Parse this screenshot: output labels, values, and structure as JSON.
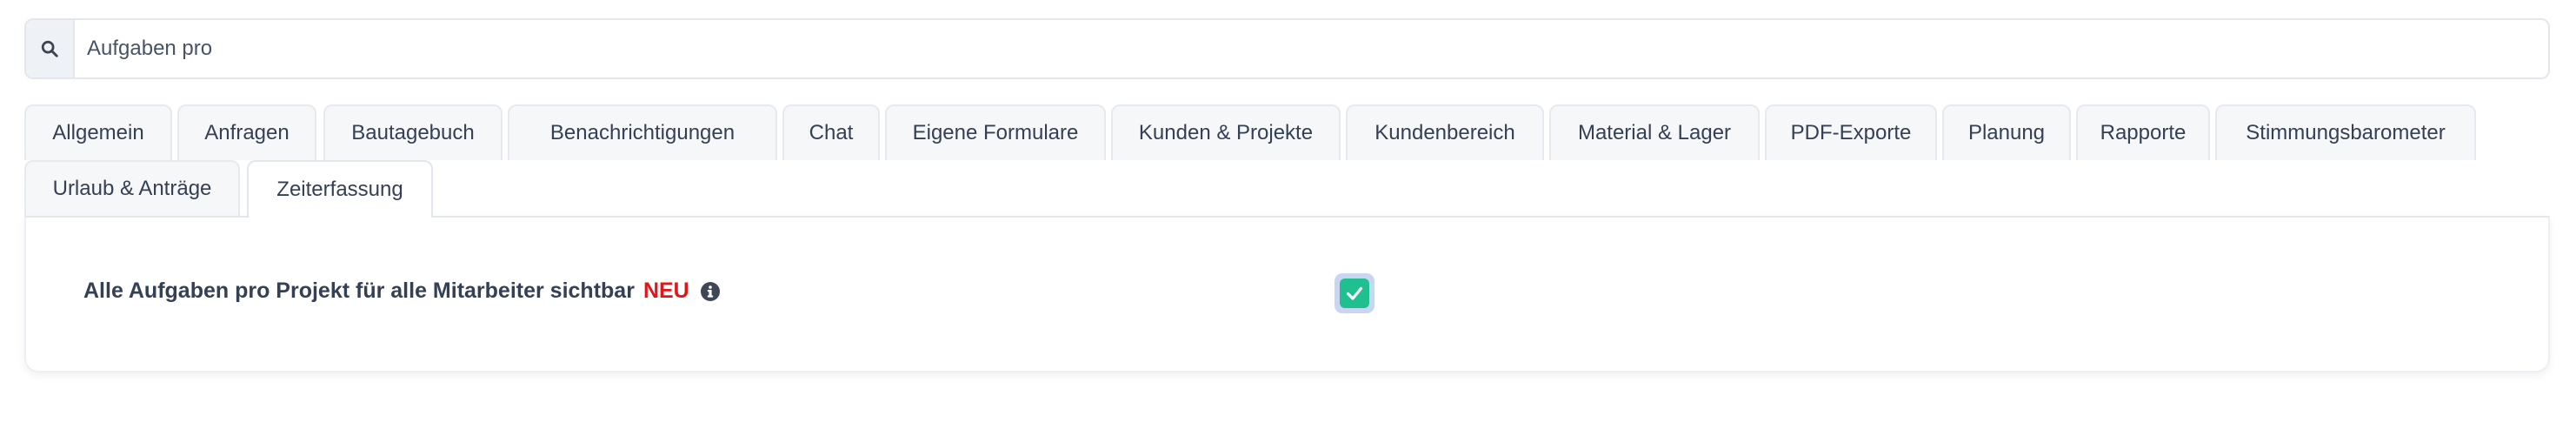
{
  "search": {
    "value": "Aufgaben pro",
    "icon": "search-icon"
  },
  "tabs": [
    {
      "label": "Allgemein",
      "active": false
    },
    {
      "label": "Anfragen",
      "active": false
    },
    {
      "label": "Bautagebuch",
      "active": false
    },
    {
      "label": "Benachrichtigungen",
      "active": false
    },
    {
      "label": "Chat",
      "active": false
    },
    {
      "label": "Eigene Formulare",
      "active": false
    },
    {
      "label": "Kunden & Projekte",
      "active": false
    },
    {
      "label": "Kundenbereich",
      "active": false
    },
    {
      "label": "Material & Lager",
      "active": false
    },
    {
      "label": "PDF-Exporte",
      "active": false
    },
    {
      "label": "Planung",
      "active": false
    },
    {
      "label": "Rapporte",
      "active": false
    },
    {
      "label": "Stimmungsbarometer",
      "active": false
    },
    {
      "label": "Urlaub & Anträge",
      "active": false
    },
    {
      "label": "Zeiterfassung",
      "active": true
    }
  ],
  "setting": {
    "label": "Alle Aufgaben pro Projekt für alle Mitarbeiter sichtbar",
    "badge": "NEU",
    "checked": true
  },
  "colors": {
    "accent_green": "#1fbf8f",
    "badge_red": "#e0161a",
    "text": "#344054"
  }
}
